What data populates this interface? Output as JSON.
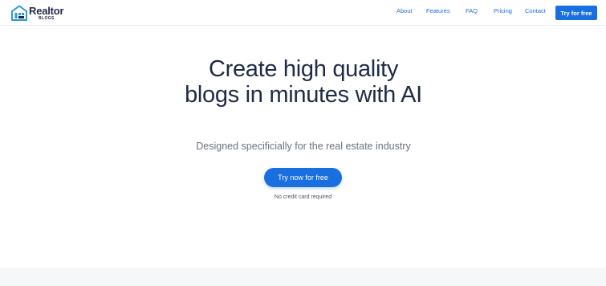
{
  "brand": {
    "name": "Realtor",
    "sub": "BLOGS",
    "logo_icon": "house-logo-icon",
    "accent_color": "#1a6fe0",
    "logo_color": "#2b9ad8"
  },
  "nav": {
    "links": [
      "About",
      "Features",
      "FAQ",
      "Pricing",
      "Contact"
    ],
    "cta_label": "Try for free"
  },
  "hero": {
    "title": "Create high quality blogs in minutes with AI",
    "subtitle": "Designed specificially for the real estate industry",
    "cta_label": "Try now for free",
    "note": "No credit card required"
  }
}
